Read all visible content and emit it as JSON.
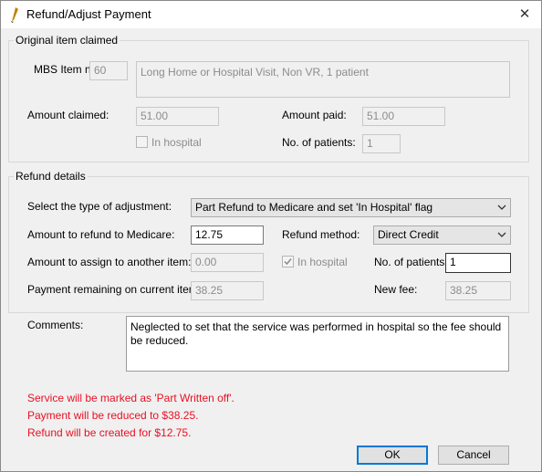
{
  "window": {
    "title": "Refund/Adjust Payment",
    "close_glyph": "✕"
  },
  "original": {
    "legend": "Original item claimed",
    "mbs_label": "MBS Item no:",
    "mbs_value": "60",
    "description": "Long Home or Hospital Visit, Non VR, 1 patient",
    "amount_claimed_label": "Amount claimed:",
    "amount_claimed_value": "51.00",
    "amount_paid_label": "Amount paid:",
    "amount_paid_value": "51.00",
    "in_hospital_label": "In hospital",
    "patients_label": "No. of patients:",
    "patients_value": "1"
  },
  "refund": {
    "legend": "Refund details",
    "type_label": "Select the type of adjustment:",
    "type_value": "Part Refund to Medicare and set 'In Hospital' flag",
    "refund_amount_label": "Amount to refund to Medicare:",
    "refund_amount_value": "12.75",
    "method_label": "Refund method:",
    "method_value": "Direct Credit",
    "assign_label": "Amount to assign to another item:",
    "assign_value": "0.00",
    "in_hospital_label": "In hospital",
    "in_hospital_checked": true,
    "patients_label": "No. of patients:",
    "patients_value": "1",
    "remaining_label": "Payment remaining on current item:",
    "remaining_value": "38.25",
    "new_fee_label": "New fee:",
    "new_fee_value": "38.25"
  },
  "comments": {
    "label": "Comments:",
    "text": "Neglected to set that the service was performed in hospital so the fee should be reduced."
  },
  "messages": [
    "Service will be marked as 'Part Written off'.",
    "Payment will be reduced to $38.25.",
    "Refund will be created for $12.75."
  ],
  "buttons": {
    "ok": "OK",
    "cancel": "Cancel"
  },
  "colors": {
    "message": "#e81123",
    "default_button_border": "#0078d7"
  },
  "icons": {
    "app": "app-icon",
    "close": "close-icon",
    "dropdown": "chevron-down-icon",
    "check": "checkmark-icon"
  }
}
